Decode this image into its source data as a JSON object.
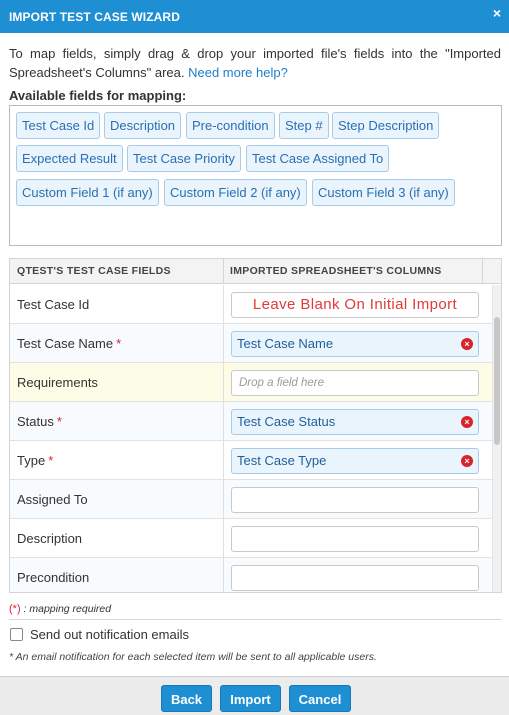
{
  "dialog": {
    "title": "IMPORT TEST CASE WIZARD",
    "close_glyph": "×",
    "close_icon": "close-icon"
  },
  "intro": {
    "text": "To map fields, simply drag & drop your imported file's fields into the \"Imported Spreadsheet's Columns\" area.",
    "help_link": "Need more help?"
  },
  "available": {
    "label": "Available fields for mapping:",
    "fields": [
      "Test Case Id",
      "Description",
      "Pre-condition",
      "Step #",
      "Step Description",
      "Expected Result",
      "Test Case Priority",
      "Test Case Assigned To",
      "Custom Field 1 (if any)",
      "Custom Field 2 (if any)",
      "Custom Field 3 (if any)"
    ]
  },
  "mapping": {
    "col1": "QTEST'S TEST CASE FIELDS",
    "col2": "IMPORTED SPREADSHEET'S COLUMNS",
    "required_marker": "*",
    "remove_glyph": "×",
    "rows": [
      {
        "field": "Test Case Id",
        "required": false,
        "mapped": "Leave Blank On Initial Import",
        "kind": "fixed"
      },
      {
        "field": "Test Case Name",
        "required": true,
        "mapped": "Test Case Name",
        "kind": "filled"
      },
      {
        "field": "Requirements",
        "required": false,
        "placeholder": "Drop a field here",
        "kind": "placeholder"
      },
      {
        "field": "Status",
        "required": true,
        "mapped": "Test Case Status",
        "kind": "filled"
      },
      {
        "field": "Type",
        "required": true,
        "mapped": "Test Case Type",
        "kind": "filled"
      },
      {
        "field": "Assigned To",
        "required": false,
        "kind": "empty"
      },
      {
        "field": "Description",
        "required": false,
        "kind": "empty"
      },
      {
        "field": "Precondition",
        "required": false,
        "kind": "empty"
      }
    ]
  },
  "legend": {
    "marker": "(*)",
    "text": " : mapping required"
  },
  "notify": {
    "label": "Send out notification emails",
    "checked": false
  },
  "note": "* An email notification for each selected item will be sent to all applicable users.",
  "buttons": {
    "back": "Back",
    "import": "Import",
    "cancel": "Cancel"
  },
  "colors": {
    "accent": "#1e8fd3",
    "required": "#d9232b",
    "chip_bg": "#eaf4fd",
    "fixed_text": "#e03a3a"
  }
}
